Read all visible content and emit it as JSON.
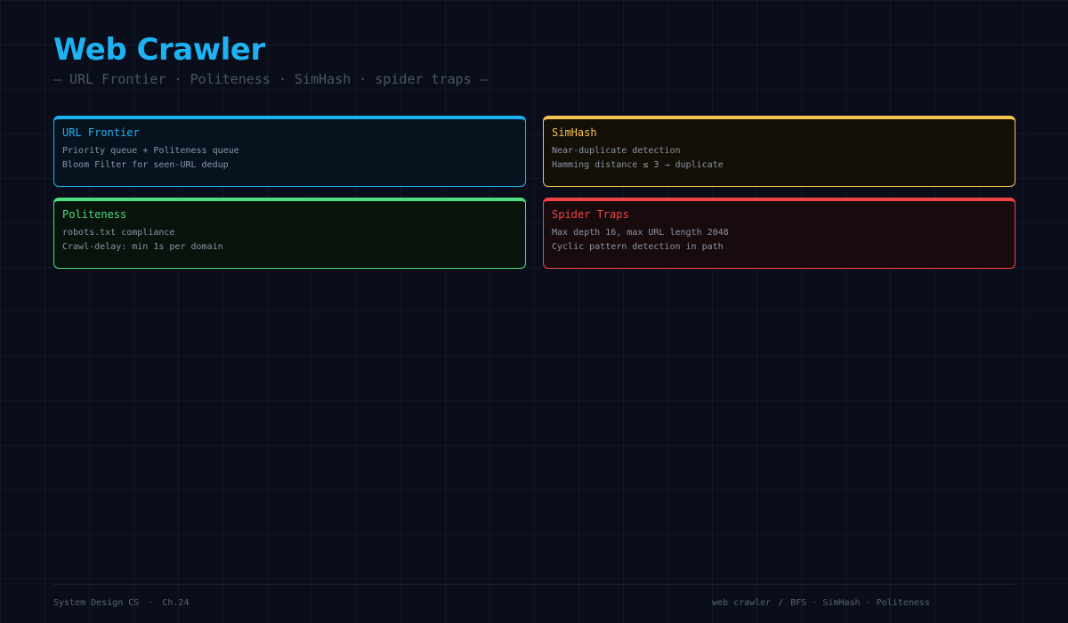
{
  "header": {
    "title": "Web Crawler",
    "subtitle": "— URL Frontier · Politeness · SimHash · spider traps —"
  },
  "cards": {
    "frontier": {
      "title": "URL Frontier",
      "lines": [
        "Priority queue + Politeness queue",
        "Bloom Filter for seen-URL dedup"
      ],
      "accent": "#1eb2f2"
    },
    "simhash": {
      "title": "SimHash",
      "lines": [
        "Near-duplicate detection",
        "Hamming distance ≤ 3 → duplicate"
      ],
      "accent": "#f5c451"
    },
    "politeness": {
      "title": "Politeness",
      "lines": [
        "robots.txt compliance",
        "Crawl-delay: min 1s per domain"
      ],
      "accent": "#4ade80"
    },
    "traps": {
      "title": "Spider Traps",
      "lines": [
        "Max depth 16, max URL length 2048",
        "Cyclic pattern detection in path"
      ],
      "accent": "#ef4444"
    }
  },
  "footer": {
    "course": "System Design CS",
    "sep": "·",
    "chapter": "Ch.24",
    "topic": "web crawler",
    "slash": "/",
    "tags": "BFS · SimHash · Politeness"
  }
}
